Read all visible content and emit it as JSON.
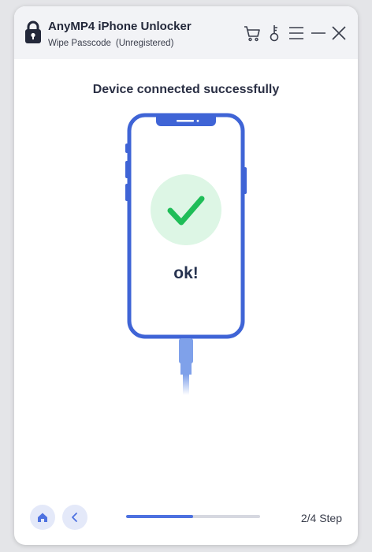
{
  "app": {
    "title": "AnyMP4 iPhone Unlocker",
    "mode": "Wipe Passcode",
    "registration_status": "(Unregistered)"
  },
  "toolbar": {
    "icons": [
      "cart-icon",
      "key-icon",
      "menu-icon",
      "minimize-icon",
      "close-icon"
    ]
  },
  "main": {
    "heading": "Device connected successfully",
    "status_text": "ok!"
  },
  "footer": {
    "home_icon": "home-icon",
    "back_icon": "chevron-left-icon",
    "progress_fraction": 0.5,
    "step_label": "2/4 Step"
  },
  "colors": {
    "accent": "#4d71e0",
    "phone_frame": "#3f64d6",
    "success_green": "#1fbd58",
    "success_bg": "#ddf6e5"
  }
}
